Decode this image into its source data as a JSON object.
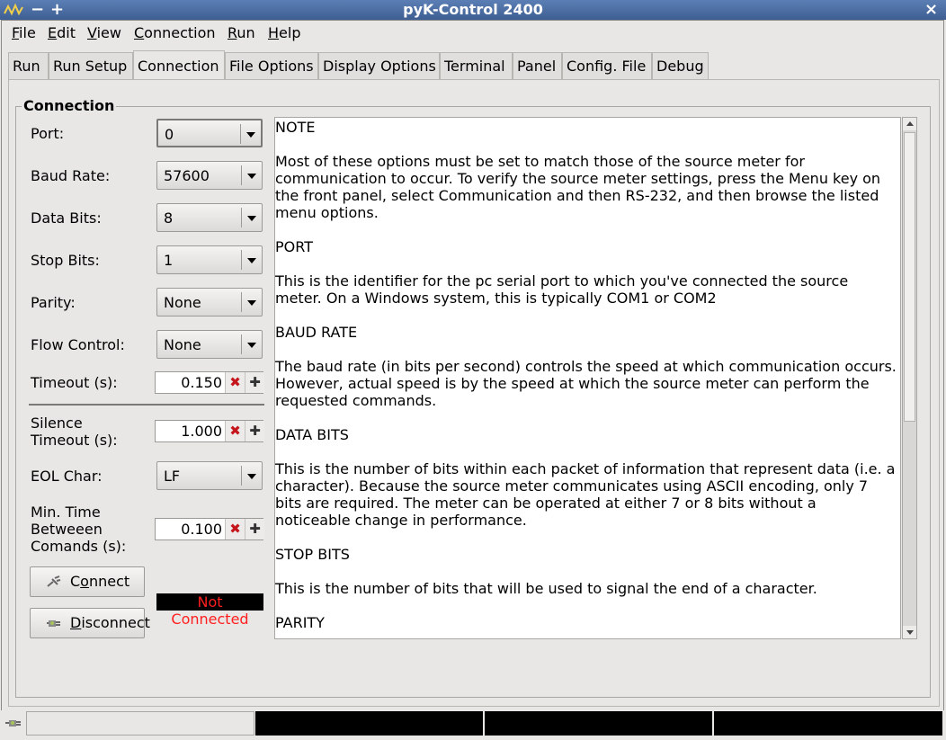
{
  "window": {
    "title": "pyK-Control 2400",
    "minimize": "−",
    "maximize": "+",
    "close": "×"
  },
  "menubar": [
    {
      "label": "File",
      "mnemonic": "F",
      "rest": "ile"
    },
    {
      "label": "Edit",
      "mnemonic": "E",
      "rest": "dit"
    },
    {
      "label": "View",
      "mnemonic": "V",
      "rest": "iew"
    },
    {
      "label": "Connection",
      "mnemonic": "C",
      "rest": "onnection"
    },
    {
      "label": "Run",
      "mnemonic": "R",
      "rest": "un"
    },
    {
      "label": "Help",
      "mnemonic": "H",
      "rest": "elp"
    }
  ],
  "tabs": [
    "Run",
    "Run Setup",
    "Connection",
    "File Options",
    "Display Options",
    "Terminal",
    "Panel",
    "Config. File",
    "Debug"
  ],
  "active_tab": "Connection",
  "connection": {
    "group_title": "Connection",
    "port": {
      "label": "Port:",
      "value": "0"
    },
    "baud_rate": {
      "label": "Baud Rate:",
      "value": "57600"
    },
    "data_bits": {
      "label": "Data Bits:",
      "value": "8"
    },
    "stop_bits": {
      "label": "Stop Bits:",
      "value": "1"
    },
    "parity": {
      "label": "Parity:",
      "value": "None"
    },
    "flow_control": {
      "label": "Flow Control:",
      "value": "None"
    },
    "timeout": {
      "label": "Timeout (s):",
      "value": "0.150"
    },
    "silence_timeout": {
      "label_line1": "Silence",
      "label_line2": "Timeout (s):",
      "value": "1.000"
    },
    "eol_char": {
      "label": "EOL Char:",
      "value": "LF"
    },
    "min_time": {
      "label_line1": "Min. Time",
      "label_line2": "Betweeen",
      "label_line3": "Comands (s):",
      "value": "0.100"
    },
    "connect_button": {
      "mnemonic_pre": "C",
      "mnemonic": "o",
      "rest": "nnect"
    },
    "disconnect_button": {
      "mnemonic": "D",
      "rest": "isconnect"
    },
    "status": "Not Connected"
  },
  "help_text": {
    "note_heading": "NOTE",
    "note_lines": [
      "Most of these options must be set to match those of the source meter for",
      "communication to occur. To verify the source meter settings, press the Menu key on",
      "the front panel, select Communication and then RS-232, and then browse the listed",
      "menu options."
    ],
    "port_heading": "PORT",
    "port_lines": [
      "This is the identifier for the pc serial port to which you've connected the source",
      "meter. On a Windows system, this is typically COM1 or COM2"
    ],
    "baud_heading": "BAUD RATE",
    "baud_lines": [
      "The baud rate (in bits per second) controls the speed at which communication occurs.",
      "However, actual speed is by the speed at which the source meter can perform the",
      "requested commands."
    ],
    "data_heading": "DATA BITS",
    "data_lines": [
      "This is the number of bits within each packet of information that represent data (i.e. a",
      "character). Because the source meter communicates using ASCII encoding, only 7",
      "bits are required. The meter can be operated at either 7 or 8 bits without a",
      "noticeable change in performance."
    ],
    "stop_heading": "STOP BITS",
    "stop_lines": [
      "This is the number of bits that will be used to signal the end of a character."
    ],
    "parity_heading": "PARITY"
  },
  "icons": {
    "app": "waveform-icon",
    "connect": "plug-icon",
    "disconnect": "unplug-icon",
    "clear": "x-icon",
    "increment": "plus-icon"
  },
  "colors": {
    "titlebar": "#3e5e92",
    "status_bg": "#000000",
    "status_text": "#ff1f1f",
    "clear_icon": "#c4161c"
  }
}
